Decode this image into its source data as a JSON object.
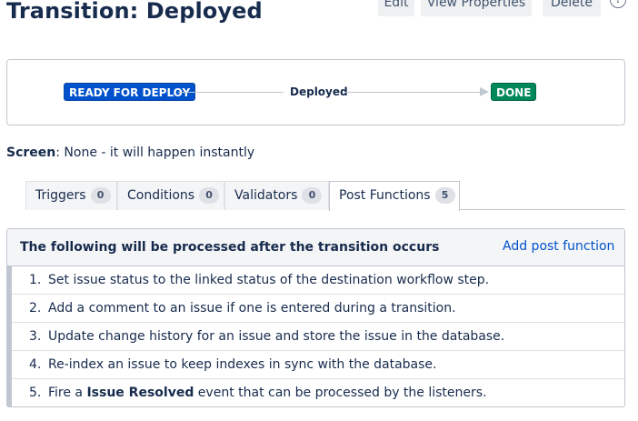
{
  "header": {
    "title": "Transition: Deployed",
    "buttons": {
      "edit": "Edit",
      "view_properties": "View Properties",
      "delete": "Delete"
    },
    "help_icon": "?"
  },
  "diagram": {
    "from_status": "READY FOR DEPLOY",
    "transition": "Deployed",
    "to_status": "DONE",
    "colors": {
      "from": "#0052cc",
      "to": "#00875a"
    }
  },
  "screen": {
    "label": "Screen",
    "value": ": None - it will happen instantly"
  },
  "tabs": [
    {
      "label": "Triggers",
      "count": "0"
    },
    {
      "label": "Conditions",
      "count": "0"
    },
    {
      "label": "Validators",
      "count": "0"
    },
    {
      "label": "Post Functions",
      "count": "5"
    }
  ],
  "panel": {
    "title": "The following will be processed after the transition occurs",
    "add_link": "Add post function",
    "items": [
      {
        "num": "1.",
        "text": "Set issue status to the linked status of the destination workflow step."
      },
      {
        "num": "2.",
        "text": "Add a comment to an issue if one is entered during a transition."
      },
      {
        "num": "3.",
        "text": "Update change history for an issue and store the issue in the database."
      },
      {
        "num": "4.",
        "text": "Re-index an issue to keep indexes in sync with the database."
      },
      {
        "num": "5.",
        "pre": "Fire a ",
        "bold": "Issue Resolved",
        "post": " event that can be processed by the listeners."
      }
    ]
  }
}
